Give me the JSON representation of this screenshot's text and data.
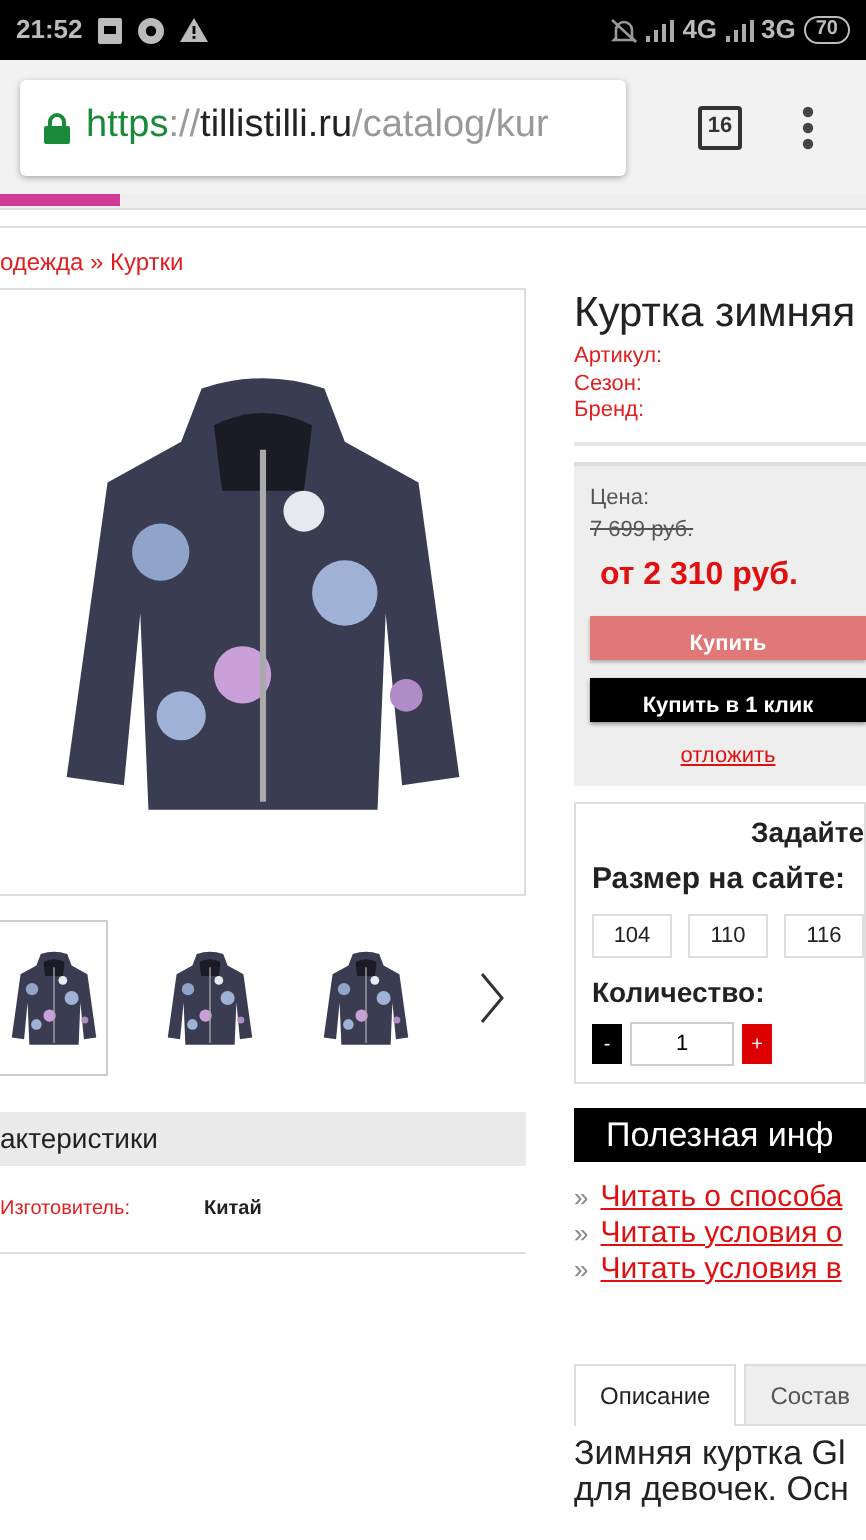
{
  "status_bar": {
    "time": "21:52",
    "network_1": "4G",
    "network_2": "3G",
    "battery": "70"
  },
  "browser": {
    "url_scheme": "https",
    "url_sep": "://",
    "url_host": "tillistilli.ru",
    "url_path": "/catalog/kur",
    "secure": true,
    "tab_count": "16"
  },
  "breadcrumb": [
    {
      "label": "одежда"
    },
    {
      "label": "Куртки"
    }
  ],
  "breadcrumb_separator": "»",
  "gallery": {
    "thumbnails": [
      {
        "selected": true
      },
      {
        "selected": false
      },
      {
        "selected": false
      }
    ]
  },
  "characteristics": {
    "heading": "актеристики",
    "rows": [
      {
        "label": "Изготовитель:",
        "value": "Китай"
      }
    ]
  },
  "product": {
    "title": "Куртка зимняя",
    "specs": [
      {
        "label": "Артикул:"
      },
      {
        "label": "Сезон:"
      },
      {
        "label": "Бренд:"
      }
    ]
  },
  "price_box": {
    "label": "Цена:",
    "old_price": "7 699 руб.",
    "price": "от 2 310 руб.",
    "buy_button": "Купить",
    "one_click_button": "Купить в 1 клик",
    "defer_link": "отложить"
  },
  "size_box": {
    "heading": "Задайте",
    "size_label": "Размер на сайте:",
    "sizes": [
      {
        "label": "104",
        "selected": false
      },
      {
        "label": "110",
        "selected": false
      },
      {
        "label": "116",
        "selected": false
      }
    ],
    "quantity_label": "Количество:",
    "minus": "-",
    "quantity": "1",
    "plus": "+"
  },
  "info": {
    "heading": "Полезная инф",
    "marker": "»",
    "links": [
      {
        "label": "Читать о способа"
      },
      {
        "label": "Читать условия о"
      },
      {
        "label": "Читать условия в"
      }
    ]
  },
  "tabs": [
    {
      "label": "Описание",
      "selected": true
    },
    {
      "label": "Состав",
      "selected": false
    }
  ],
  "description": {
    "lines": [
      "Зимняя куртка Gl",
      "для девочек. Осн"
    ]
  }
}
